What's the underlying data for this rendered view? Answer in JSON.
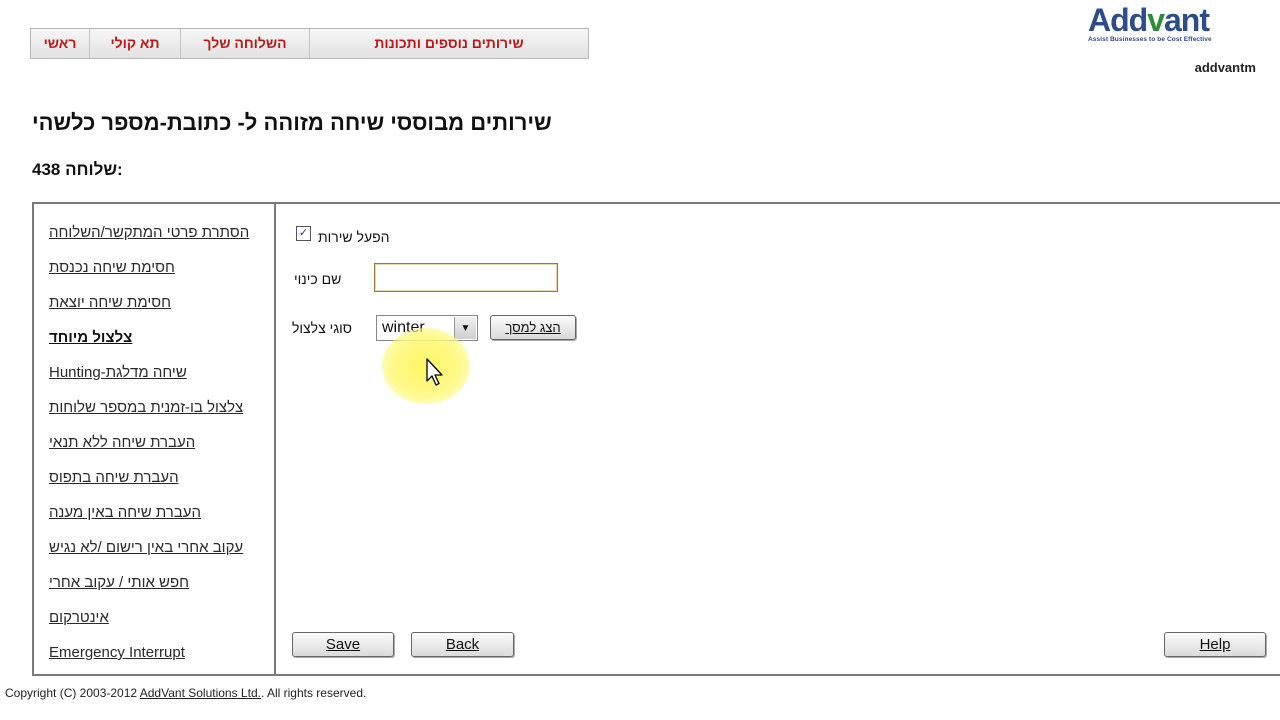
{
  "nav": {
    "tabs": [
      {
        "label": "ראשי"
      },
      {
        "label": "תא קולי"
      },
      {
        "label": "השלוחה שלך"
      },
      {
        "label": "שירותים נוספים ותכונות"
      }
    ]
  },
  "logo": {
    "name": "Addvant",
    "tagline": "Assist Businesses to be Cost Effective"
  },
  "user": {
    "name": "addvantm"
  },
  "page": {
    "title": "שירותים מבוססי שיחה מזוהה ל- כתובת-מספר כלשהי",
    "extension_label": "שלוחה:",
    "extension_number": "438"
  },
  "sidebar": {
    "items": [
      {
        "label": "הסתרת פרטי המתקשר/השלוחה"
      },
      {
        "label": "חסימת שיחה נכנסת"
      },
      {
        "label": "חסימת שיחה יוצאת"
      },
      {
        "label": "צלצול מיוחד"
      },
      {
        "label": "Hunting-שיחה מדלגת"
      },
      {
        "label": "צלצול בו-זמנית במספר שלוחות"
      },
      {
        "label": "העברת שיחה ללא תנאי"
      },
      {
        "label": "העברת שיחה בתפוס"
      },
      {
        "label": "העברת שיחה באין מענה"
      },
      {
        "label": "עקוב אחרי באין רישום /לא נגיש"
      },
      {
        "label": "חפש אותי / עקוב אחרי"
      },
      {
        "label": "אינטרקום"
      },
      {
        "label": "Emergency Interrupt"
      }
    ],
    "active_index": 3
  },
  "form": {
    "enable_label": "הפעל שירות",
    "enable_checked": true,
    "check_mark": "✓",
    "nickname_label": "שם כינוי",
    "nickname_value": "",
    "ring_type_label": "סוגי צלצול",
    "ring_type_value": "winter",
    "play_button": "הצג למסך"
  },
  "buttons": {
    "save": "Save",
    "back": "Back",
    "help": "Help"
  },
  "footer": {
    "prefix": "Copyright (C) 2003-2012 ",
    "link": "AddVant Solutions Ltd.",
    "suffix": ". All rights reserved."
  }
}
